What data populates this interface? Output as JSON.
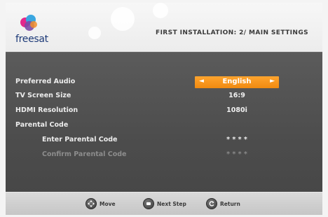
{
  "header": {
    "logo_text": "freesat",
    "title": "FIRST INSTALLATION: 2/ MAIN SETTINGS"
  },
  "settings": [
    {
      "label": "Preferred Audio",
      "value": "English",
      "selected": true
    },
    {
      "label": "TV Screen Size",
      "value": "16:9"
    },
    {
      "label": "HDMI Resolution",
      "value": "1080i"
    },
    {
      "label": "Parental Code",
      "value": ""
    },
    {
      "label": "Enter Parental Code",
      "value": "* * * *"
    },
    {
      "label": "Confirm Parental Code",
      "value": "* * * *",
      "disabled": true
    }
  ],
  "selector_arrows": {
    "left": "◄",
    "right": "►"
  },
  "footer": {
    "hints": [
      {
        "icon": "move-icon",
        "label": "Move"
      },
      {
        "icon": "ok-button-icon",
        "label": "Next Step"
      },
      {
        "icon": "return-icon",
        "label": "Return"
      }
    ]
  },
  "colors": {
    "accent": "#f39418",
    "panel": "#505050",
    "logo_text": "#1d3a78"
  }
}
